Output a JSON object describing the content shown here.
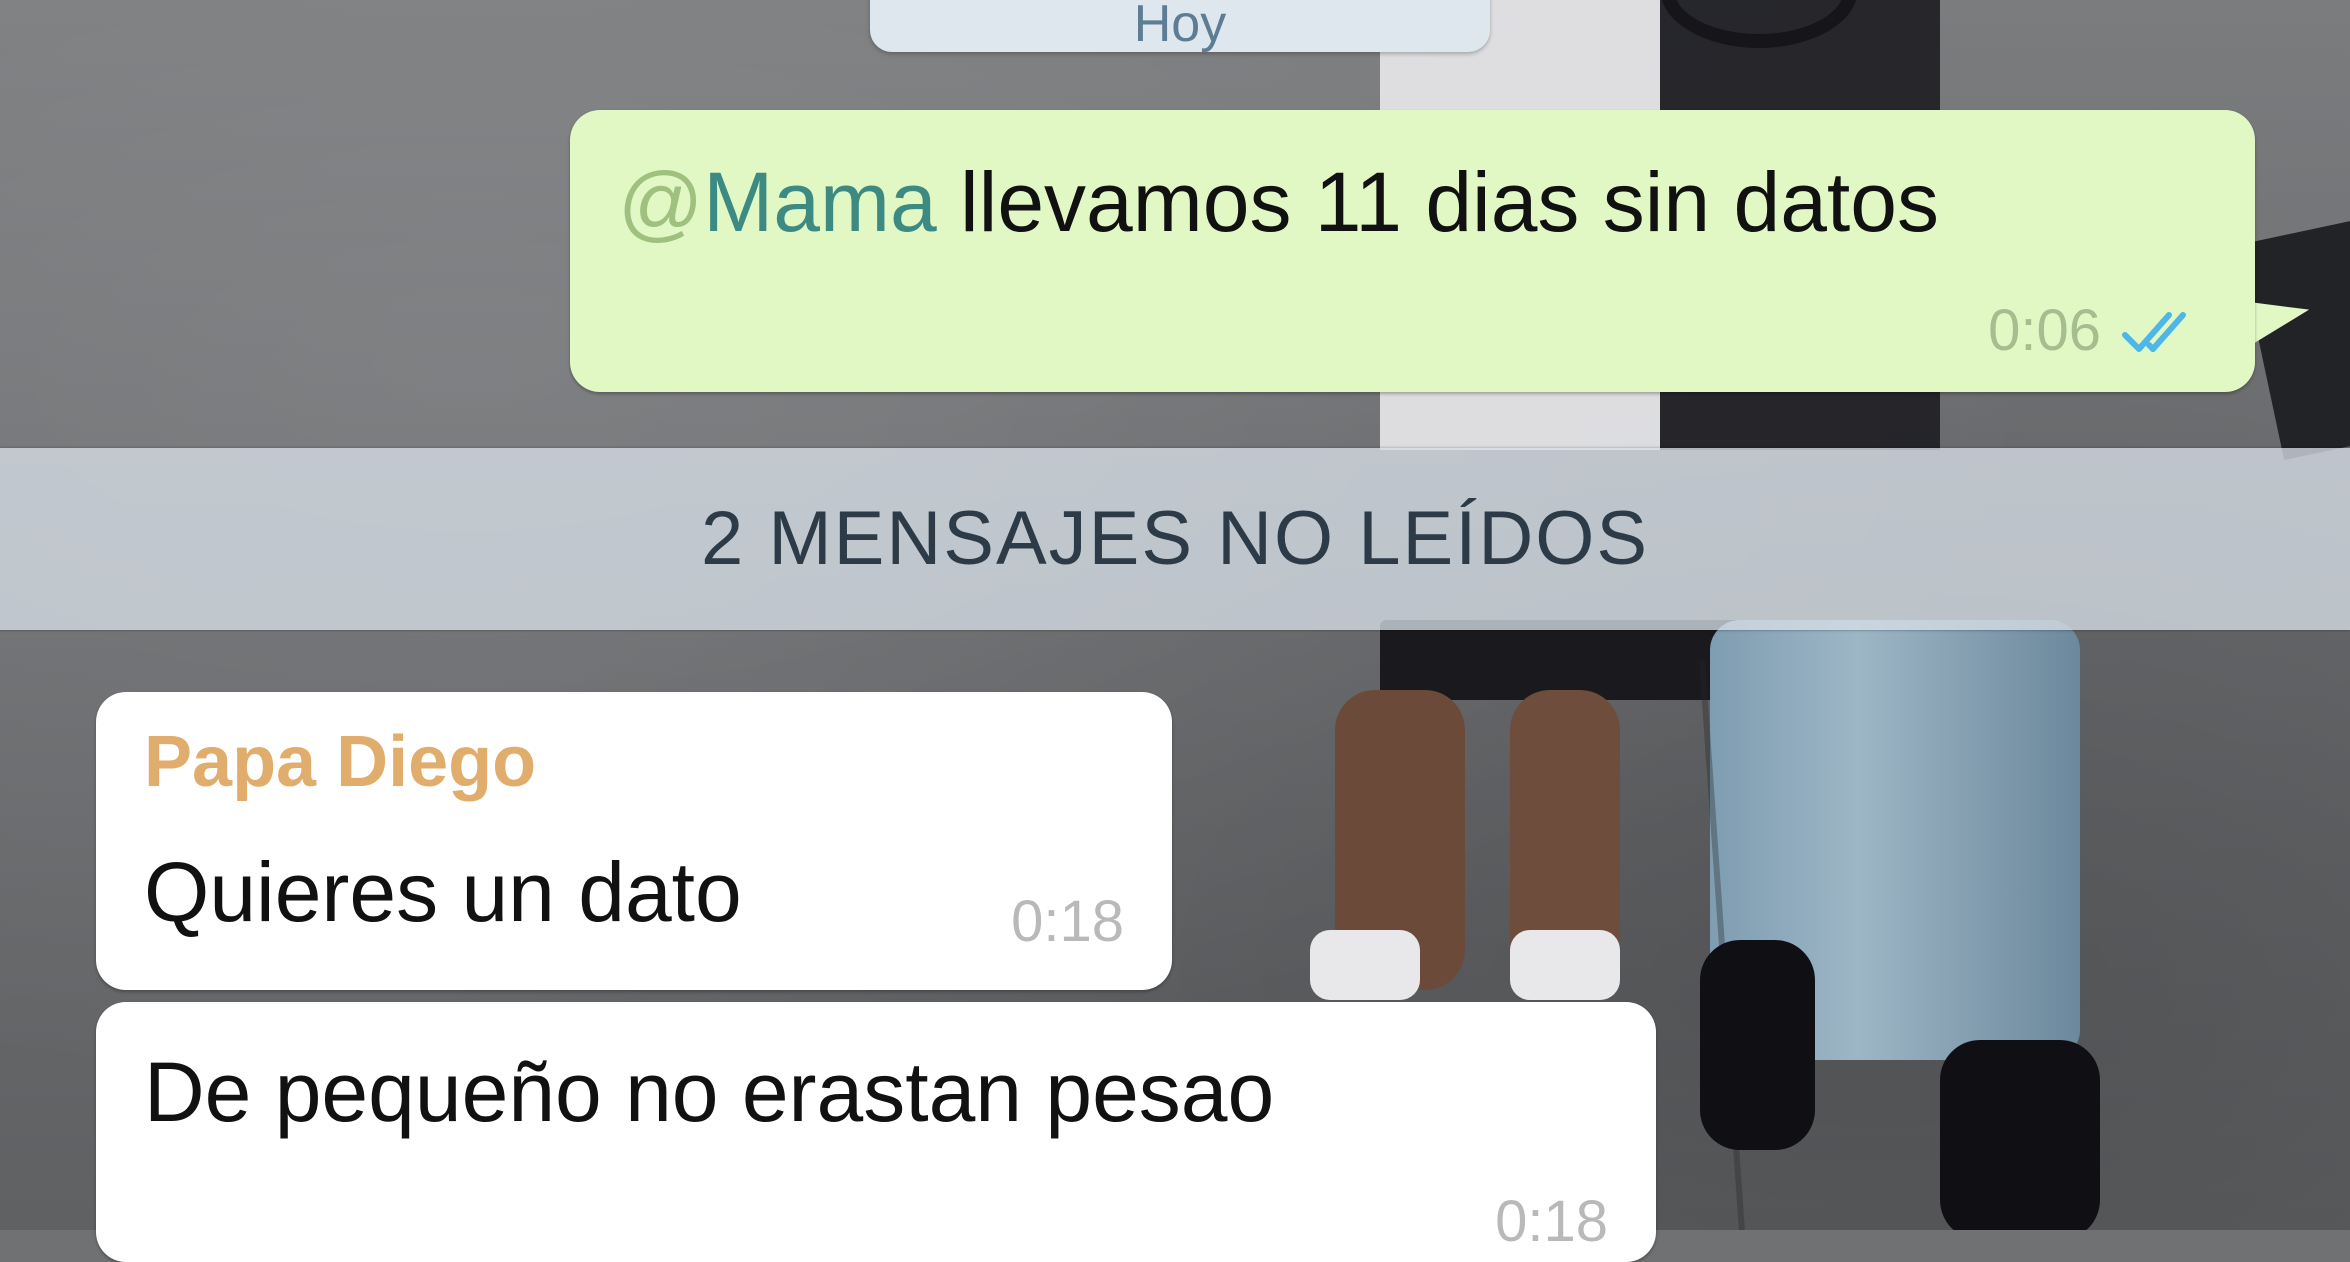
{
  "date_chip": {
    "label": "Hoy"
  },
  "outgoing_message": {
    "mention_at": "@",
    "mention_name": "Mama",
    "text": " llevamos 11 dias sin datos",
    "time": "0:06",
    "status_icon": "double-check-read-icon"
  },
  "unread_banner": {
    "label": "2 MENSAJES NO LEÍDOS"
  },
  "incoming_messages": [
    {
      "sender": "Papa Diego",
      "text": "Quieres un dato",
      "time": "0:18"
    },
    {
      "text": "De pequeño no erastan pesao",
      "time": "0:18"
    }
  ],
  "colors": {
    "outgoing_bubble": "#e1f8c5",
    "incoming_bubble": "#ffffff",
    "sender_name": "#e0ad6c",
    "mention": "#3d8a83",
    "read_ticks": "#4fb6e8"
  }
}
